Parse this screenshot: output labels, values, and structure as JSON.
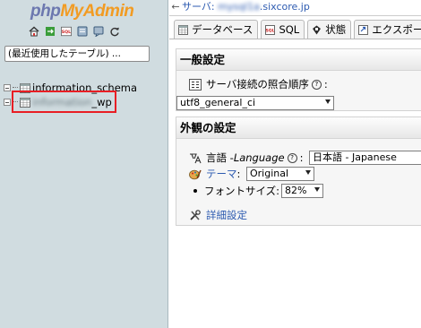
{
  "nav": {
    "logo_part1": "php",
    "logo_part2": "MyAdmin",
    "icons": [
      "home-icon",
      "exit-icon",
      "sql-icon",
      "docs-icon",
      "settings-icon",
      "reload-icon"
    ],
    "recent_tables_label": "(最近使用したテーブル) ...",
    "databases": [
      {
        "name": "information_schema"
      },
      {
        "name_blurred": "information",
        "name_suffix": "_wp"
      }
    ]
  },
  "breadcrumb": {
    "server_label": "サーバ:",
    "server_name_blurred": "mysql1a",
    "server_domain": ".sixcore.jp"
  },
  "tabs": [
    {
      "label": "データベース",
      "icon": "database-icon"
    },
    {
      "label": "SQL",
      "icon": "sql-icon"
    },
    {
      "label": "状態",
      "icon": "status-icon"
    },
    {
      "label": "エクスポー",
      "icon": "export-icon"
    }
  ],
  "general_settings": {
    "title": "一般設定",
    "collation_label": "サーバ接続の照合順序",
    "collation_value": "utf8_general_ci"
  },
  "appearance_settings": {
    "title": "外観の設定",
    "language_label_prefix": "言語 - ",
    "language_label_italic": "Language",
    "language_value": "日本語 - Japanese",
    "theme_label": "テーマ",
    "theme_value": "Original",
    "font_size_label": "フォントサイズ:",
    "font_size_value": "82%",
    "more_settings_label": "詳細設定"
  },
  "colors": {
    "nav_bg": "#d0dce0",
    "logo_php": "#6c78af",
    "logo_myadmin": "#f29b22",
    "link": "#2c5ab0",
    "highlight": "#e81e24"
  }
}
